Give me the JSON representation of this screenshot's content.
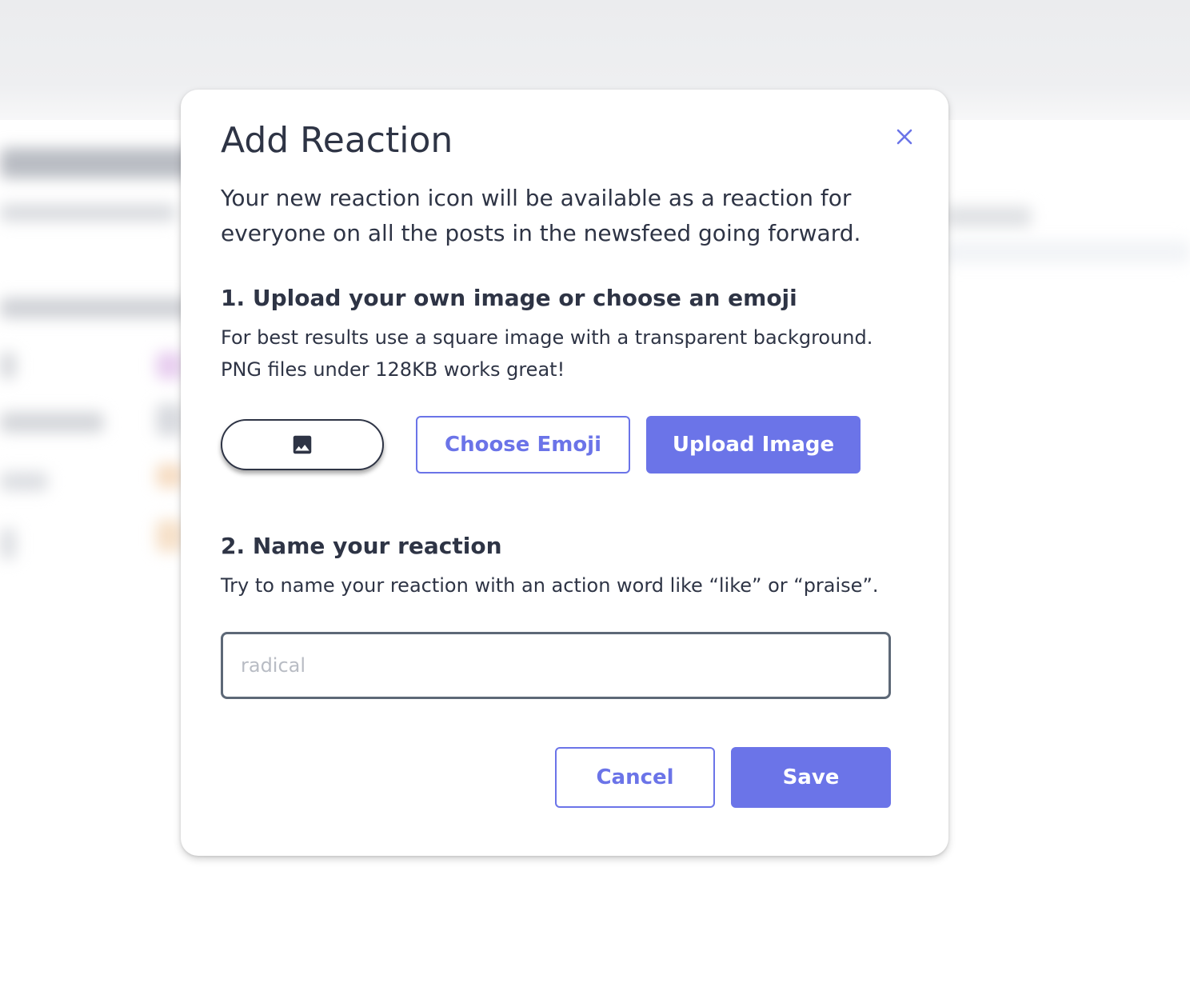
{
  "dialog": {
    "title": "Add Reaction",
    "intro": "Your new reaction icon will be available as a reaction for everyone on all the posts in the newsfeed going forward.",
    "step1": {
      "heading": "1. Upload your own image or choose an emoji",
      "help_line1": "For best results use a square image with a transparent background.",
      "help_line2": "PNG files under 128KB works great!"
    },
    "buttons": {
      "choose_emoji": "Choose Emoji",
      "upload_image": "Upload Image",
      "cancel": "Cancel",
      "save": "Save"
    },
    "step2": {
      "heading": "2. Name your reaction",
      "help": "Try to name your reaction with an action word like “like” or “praise”."
    },
    "name_input": {
      "placeholder": "radical",
      "value": ""
    },
    "icons": {
      "close": "close-icon",
      "preview": "image-icon"
    },
    "colors": {
      "accent": "#6b74e8",
      "text": "#2e3445",
      "input_border": "#5d6877"
    }
  }
}
